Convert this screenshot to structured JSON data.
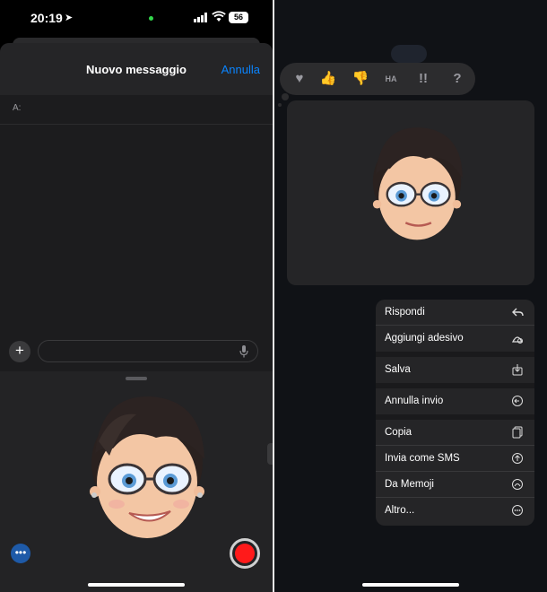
{
  "status_bar": {
    "time": "20:19",
    "battery": "56"
  },
  "compose": {
    "title": "Nuovo messaggio",
    "cancel_label": "Annulla",
    "to_label": "A:",
    "add_symbol": "+",
    "more_symbol": "•••"
  },
  "tapbacks": [
    {
      "name": "heart-icon",
      "glyph": "♥"
    },
    {
      "name": "thumbs-up-icon",
      "glyph": "👍"
    },
    {
      "name": "thumbs-down-icon",
      "glyph": "👎"
    },
    {
      "name": "haha-icon",
      "glyph": "HA"
    },
    {
      "name": "exclamation-icon",
      "glyph": "!!"
    },
    {
      "name": "question-icon",
      "glyph": "?"
    }
  ],
  "context_menu": [
    {
      "label": "Rispondi",
      "icon": "reply-icon"
    },
    {
      "label": "Aggiungi adesivo",
      "icon": "sticker-icon"
    },
    {
      "label": "Salva",
      "icon": "save-icon"
    },
    {
      "label": "Annulla invio",
      "icon": "undo-send-icon"
    },
    {
      "label": "Copia",
      "icon": "copy-icon"
    },
    {
      "label": "Invia come SMS",
      "icon": "send-sms-icon"
    },
    {
      "label": "Da Memoji",
      "icon": "memoji-icon"
    },
    {
      "label": "Altro...",
      "icon": "more-icon"
    }
  ],
  "colors": {
    "accent": "#0a84ff",
    "record": "#ff1a1a",
    "status_dot": "#32d74b"
  }
}
